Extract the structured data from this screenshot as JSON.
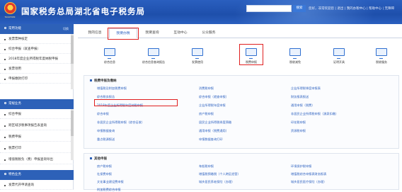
{
  "header": {
    "title": "国家税务总局湖北省电子税务局",
    "emblem_caption": "TAXATION",
    "search_button": "搜索",
    "top_links": "您好，非常欢迎您 | 退出 | 我的办税中心 | 帮助中心 | 无障碍"
  },
  "sidebar": {
    "sections": [
      {
        "title": "常用功能",
        "action": "切换",
        "items": [
          "发票票种核定",
          "综合申报（就查申报）",
          "2018年度企业所得税年度纳税申报",
          "发票领用",
          "申报缴款打印"
        ]
      },
      {
        "title": "常规业务",
        "action": "",
        "items": [
          "综合申报",
          "跨区域涉税事项报告表查询",
          "税费申报",
          "税票打印",
          "增值税税负（费）申报查询导出"
        ]
      },
      {
        "title": "特色业务",
        "action": "",
        "items": [
          "发票代开申请查询"
        ]
      }
    ]
  },
  "tabs": [
    "我的信息",
    "我要办税",
    "我要查询",
    "互动中心",
    "公众服务"
  ],
  "icons": [
    "综合信息",
    "综合信息查询报告",
    "发票使用",
    "税费申报",
    "税收减免",
    "证明开具",
    "税收服务"
  ],
  "panels": {
    "declare": {
      "title": "税费申报及缴纳",
      "col1": [
        "增值税及附加税费申报",
        "综合税务报告",
        "2018年度企业所得税年度纳税申报",
        "综合申报",
        "非居民企业所得税申报（综合征收）",
        "申报数据查询",
        "重点税源报送"
      ],
      "col2": [
        "消费税申报",
        "综合申报（就查申报）",
        "企业所得税年度申报",
        "房产税申报",
        "居民企业所得税季度预缴",
        "通用申报（税费通用）",
        "申报数据查询打印"
      ],
      "col3": [
        "企业所得税季度申报表",
        "财务报表报送",
        "通用申报（税费）",
        "非居民企业所得税申报（源泉扣缴）",
        "印花税申报",
        "资源税申报"
      ]
    },
    "other": {
      "title": "其他申报",
      "col1": [
        "房产税申报",
        "社保费申报",
        "文化事业建设费申报",
        "附加税费综合申报"
      ],
      "col2": [
        "车船税申报",
        "增值税预缴税（个人跨区经营）",
        "城乡居民养老保险（办理）"
      ],
      "col3": [
        "环境保护税申报",
        "增值税综合申报表财务报表",
        "城乡居民医疗保险（办理）"
      ]
    }
  },
  "colors": {
    "header": "#1e4fab",
    "link": "#2a5fbf",
    "highlight": "#e02020"
  }
}
